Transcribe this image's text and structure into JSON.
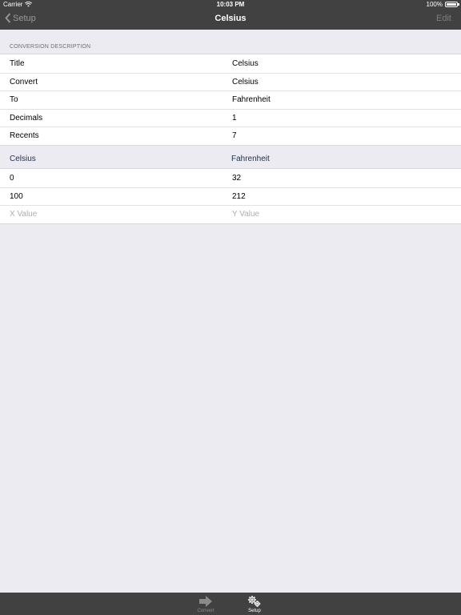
{
  "status": {
    "carrier": "Carrier",
    "time": "10:03 PM",
    "battery": "100%"
  },
  "nav": {
    "back_label": "Setup",
    "title": "Celsius",
    "edit_label": "Edit"
  },
  "description": {
    "header": "CONVERSION DESCRIPTION",
    "rows": [
      {
        "label": "Title",
        "value": "Celsius"
      },
      {
        "label": "Convert",
        "value": "Celsius"
      },
      {
        "label": "To",
        "value": "Fahrenheit"
      },
      {
        "label": "Decimals",
        "value": "1"
      },
      {
        "label": "Recents",
        "value": "7"
      }
    ]
  },
  "table": {
    "col_x": "Celsius",
    "col_y": "Fahrenheit",
    "rows": [
      {
        "x": "0",
        "y": "32"
      },
      {
        "x": "100",
        "y": "212"
      }
    ],
    "placeholder_x": "X Value",
    "placeholder_y": "Y Value"
  },
  "tabs": [
    {
      "label": "Convert",
      "icon": "arrow-right-icon",
      "selected": false
    },
    {
      "label": "Setup",
      "icon": "gears-icon",
      "selected": true
    }
  ],
  "colors": {
    "bar": "#414141",
    "background": "#ebebf1",
    "section_text": "#6d6d72",
    "placeholder": "#aeaeb3"
  }
}
